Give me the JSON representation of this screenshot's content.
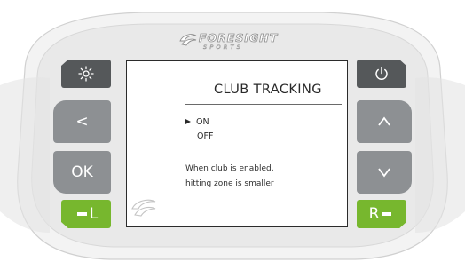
{
  "device": {
    "brand": {
      "wordmark": "FORESIGHT",
      "subline": "SPORTS",
      "icon": "foresight-swoosh-icon"
    },
    "colors": {
      "body_outer": "#f2f2f2",
      "body_inner": "#e6e6e6",
      "button_dark": "#55585a",
      "button_gray": "#8d9093",
      "button_green": "#77b72e"
    },
    "buttons": {
      "brightness": {
        "icon": "brightness-icon"
      },
      "power": {
        "icon": "power-icon"
      },
      "left": {
        "label": "<"
      },
      "ok": {
        "label": "OK"
      },
      "up": {
        "label": "^",
        "icon": "chevron-up-icon"
      },
      "down": {
        "label": "v",
        "icon": "chevron-down-icon"
      },
      "l": {
        "label": "L"
      },
      "r": {
        "label": "R"
      }
    }
  },
  "screen": {
    "title": "CLUB TRACKING",
    "options": [
      {
        "label": "ON",
        "selected": true
      },
      {
        "label": "OFF",
        "selected": false
      }
    ],
    "info_line1": "When club is enabled,",
    "info_line2": "hitting zone is smaller"
  }
}
